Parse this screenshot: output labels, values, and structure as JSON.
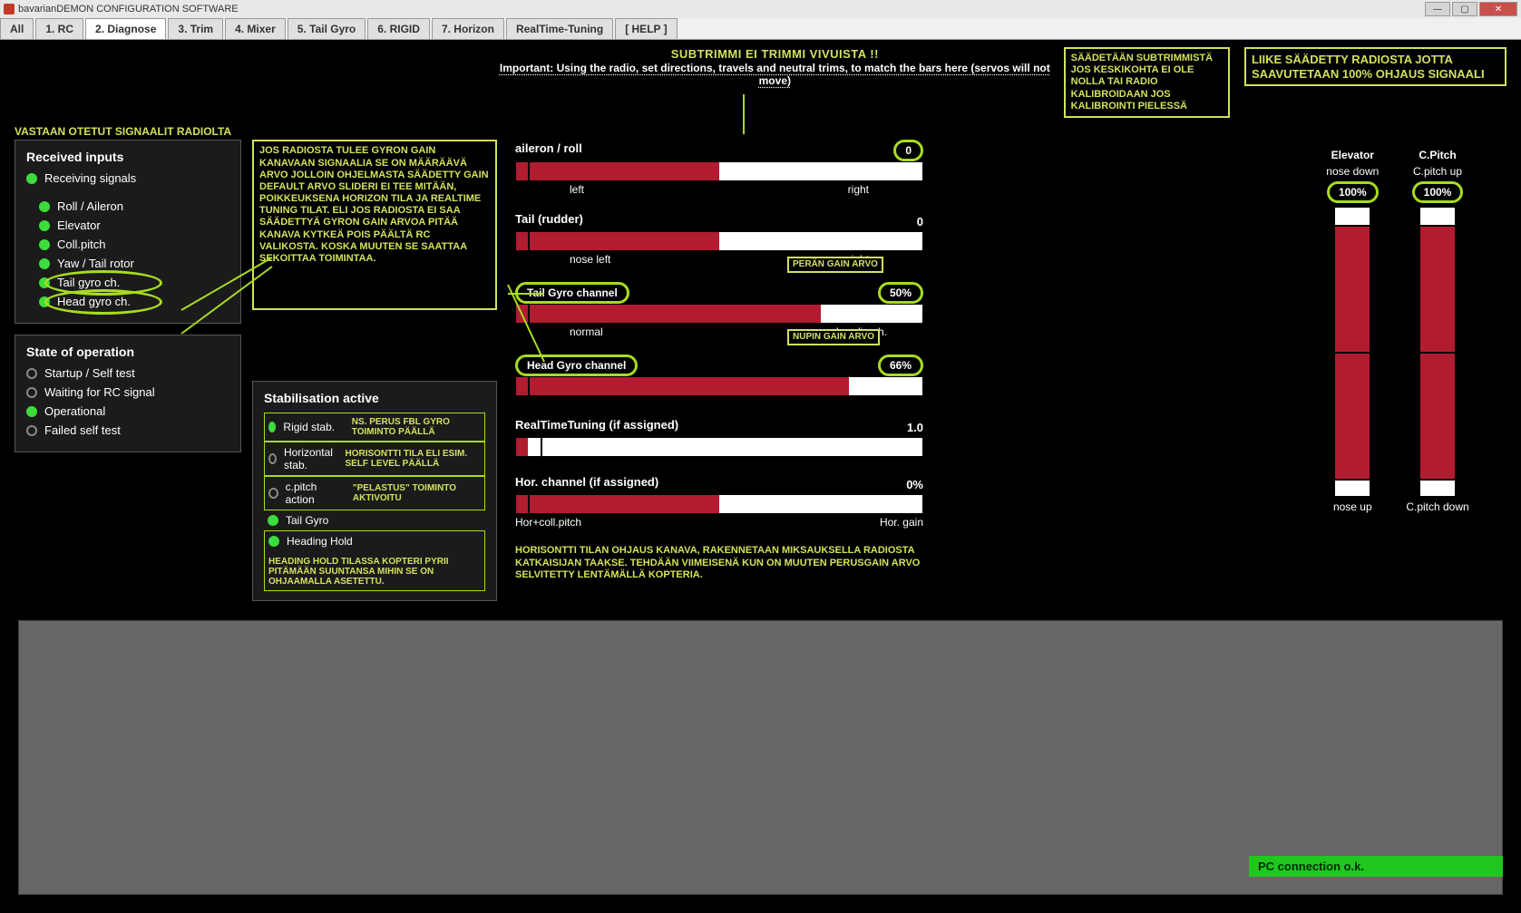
{
  "title": "bavarianDEMON CONFIGURATION SOFTWARE",
  "tabs": [
    "All",
    "1. RC",
    "2. Diagnose",
    "3. Trim",
    "4. Mixer",
    "5. Tail Gyro",
    "6. RIGID",
    "7. Horizon",
    "RealTime-Tuning",
    "[ HELP ]"
  ],
  "active_tab": 2,
  "header": {
    "subtrim_warn": "SUBTRIMMI EI TRIMMI VIVUISTA !!",
    "important": "Important: Using the radio, set directions, travels and neutral trims, to match the bars here  (servos will not move)",
    "subtrim_note": "SÄÄDETÄÄN SUBTRIMMISTÄ JOS KESKIKOHTA EI OLE NOLLA TAI RADIO KALIBROIDAAN JOS KALIBROINTI PIELESSÄ",
    "right_note": "LIIKE SÄÄDETTY RADIOSTA JOTTA SAAVUTETAAN 100% OHJAUS SIGNAALI"
  },
  "received": {
    "section_label": "VASTAAN OTETUT SIGNAALIT RADIOLTA",
    "title": "Received inputs",
    "receiving": "Receiving signals",
    "items": [
      "Roll / Aileron",
      "Elevator",
      "Coll.pitch",
      "Yaw / Tail rotor",
      "Tail gyro ch.",
      "Head gyro ch."
    ]
  },
  "gyro_note": "JOS RADIOSTA TULEE GYRON GAIN KANAVAAN SIGNAALIA SE ON MÄÄRÄÄVÄ ARVO JOLLOIN OHJELMASTA SÄÄDETTY GAIN DEFAULT ARVO SLIDERI EI TEE MITÄÄN, POIKKEUKSENA HORIZON TILA JA REALTIME TUNING TILAT. ELI JOS RADIOSTA EI SAA SÄÄDETTYÄ GYRON GAIN ARVOA PITÄÄ KANAVA KYTKEÄ POIS PÄÄLTÄ RC VALIKOSTA. KOSKA MUUTEN SE SAATTAA SEKOITTAA TOIMINTAA.",
  "state": {
    "title": "State of operation",
    "items": [
      {
        "label": "Startup / Self test",
        "on": false
      },
      {
        "label": "Waiting for RC signal",
        "on": false
      },
      {
        "label": "Operational",
        "on": true
      },
      {
        "label": "Failed self test",
        "on": false
      }
    ]
  },
  "stab": {
    "title": "Stabilisation active",
    "items": [
      {
        "label": "Rigid stab.",
        "on": true,
        "note": "NS. PERUS FBL GYRO TOIMINTO PÄÄLLÄ"
      },
      {
        "label": "Horizontal stab.",
        "on": false,
        "note": "HORISONTTI TILA ELI ESIM. SELF LEVEL PÄÄLLÄ"
      },
      {
        "label": "c.pitch action",
        "on": false,
        "note": "\"PELASTUS\" TOIMINTO AKTIVOITU"
      },
      {
        "label": "Tail Gyro",
        "on": true,
        "note": ""
      },
      {
        "label": "Heading Hold",
        "on": true,
        "note": ""
      }
    ],
    "hh_note": "HEADING HOLD TILASSA KOPTERI PYRII PITÄMÄÄN SUUNTANSA MIHIN SE ON OHJAAMALLA ASETETTU."
  },
  "channels": {
    "aileron": {
      "title": "aileron / roll",
      "value": "0",
      "left": "left",
      "right": "right",
      "fill_from": 0,
      "fill_to": 50,
      "marker": 3
    },
    "tail": {
      "title": "Tail (rudder)",
      "value": "0",
      "left": "nose left",
      "right": "nose right",
      "fill_from": 0,
      "fill_to": 50,
      "marker": 3
    },
    "tailgyro": {
      "title": "Tail Gyro channel",
      "value": "50%",
      "left": "normal",
      "right": "heading h.",
      "fill_from": 0,
      "fill_to": 75,
      "marker": 3,
      "note": "PERÄN GAIN ARVO"
    },
    "headgyro": {
      "title": "Head Gyro channel",
      "value": "66%",
      "left": "",
      "right": "",
      "fill_from": 0,
      "fill_to": 82,
      "marker": 3,
      "note": "NUPIN GAIN ARVO"
    },
    "rtt": {
      "title": "RealTimeTuning (if assigned)",
      "value": "1.0",
      "left": "",
      "right": "",
      "fill_from": 0,
      "fill_to": 3,
      "marker": 3
    },
    "hor": {
      "title": "Hor. channel  (if assigned)",
      "value": "0%",
      "left": "Hor+coll.pitch",
      "right": "Hor. gain",
      "fill_from": 0,
      "fill_to": 50,
      "marker": 3
    },
    "hor_note": "HORISONTTI TILAN OHJAUS KANAVA, RAKENNETAAN MIKSAUKSELLA RADIOSTA KATKAISIJAN TAAKSE. TEHDÄÄN VIIMEISENÄ KUN ON MUUTEN PERUSGAIN ARVO SELVITETTY LENTÄMÄLLÄ KOPTERIA."
  },
  "vbars": {
    "elevator": {
      "title": "Elevator",
      "top": "nose down",
      "bottom": "nose up",
      "pct": "100%",
      "top_marker": 6,
      "bot_marker": 94
    },
    "cpitch": {
      "title": "C.Pitch",
      "top": "C.pitch up",
      "bottom": "C.pitch down",
      "pct": "100%",
      "top_marker": 6,
      "bot_marker": 94
    }
  },
  "status": "PC connection o.k."
}
